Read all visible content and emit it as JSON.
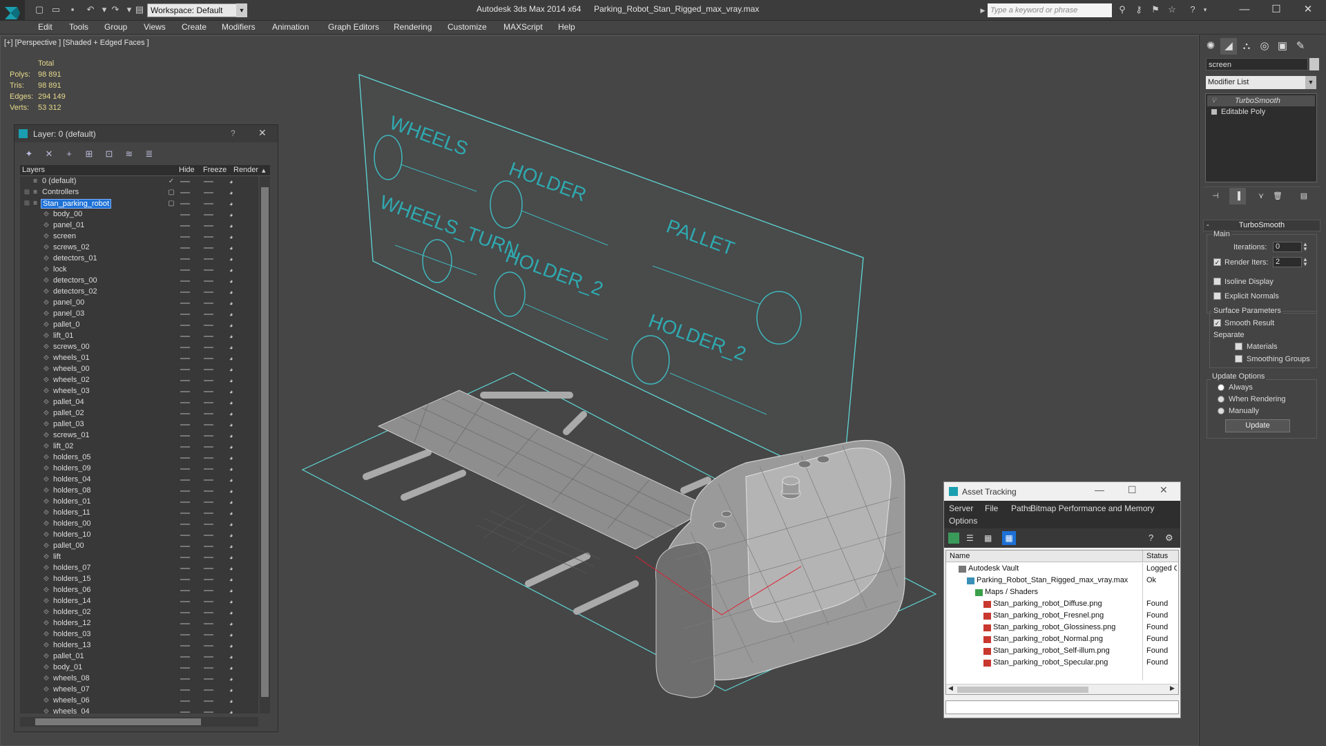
{
  "titlebar": {
    "app_title": "Autodesk 3ds Max  2014 x64",
    "doc_title": "Parking_Robot_Stan_Rigged_max_vray.max",
    "workspace": "Workspace: Default",
    "search_placeholder": "Type a keyword or phrase"
  },
  "menu": [
    "Edit",
    "Tools",
    "Group",
    "Views",
    "Create",
    "Modifiers",
    "Animation",
    "Graph Editors",
    "Rendering",
    "Customize",
    "MAXScript",
    "Help"
  ],
  "viewport": {
    "label": "[+] [Perspective ] [Shaded + Edged Faces ]",
    "stats_header": "Total",
    "stats": [
      {
        "label": "Polys:",
        "value": "98 891"
      },
      {
        "label": "Tris:",
        "value": "98 891"
      },
      {
        "label": "Edges:",
        "value": "294 149"
      },
      {
        "label": "Verts:",
        "value": "53 312"
      }
    ],
    "panel_labels": [
      "WHEELS",
      "HOLDER",
      "WHEELS_TURN",
      "HOLDER_2",
      "PALLET",
      "HOLDER_2"
    ]
  },
  "layer_window": {
    "title": "Layer: 0 (default)",
    "help": "?",
    "columns": {
      "layers": "Layers",
      "hide": "Hide",
      "freeze": "Freeze",
      "render": "Render"
    },
    "layers": [
      {
        "name": "0 (default)",
        "level": 0,
        "type": "layer",
        "check": true
      },
      {
        "name": "Controllers",
        "level": 0,
        "type": "layer",
        "box": true
      },
      {
        "name": "Stan_parking_robot",
        "level": 0,
        "type": "layer",
        "box": true,
        "selected": true
      },
      {
        "name": "body_00",
        "level": 1
      },
      {
        "name": "panel_01",
        "level": 1
      },
      {
        "name": "screen",
        "level": 1
      },
      {
        "name": "screws_02",
        "level": 1
      },
      {
        "name": "detectors_01",
        "level": 1
      },
      {
        "name": "lock",
        "level": 1
      },
      {
        "name": "detectors_00",
        "level": 1
      },
      {
        "name": "detectors_02",
        "level": 1
      },
      {
        "name": "panel_00",
        "level": 1
      },
      {
        "name": "panel_03",
        "level": 1
      },
      {
        "name": "pallet_0",
        "level": 1
      },
      {
        "name": "lift_01",
        "level": 1
      },
      {
        "name": "screws_00",
        "level": 1
      },
      {
        "name": "wheels_01",
        "level": 1
      },
      {
        "name": "wheels_00",
        "level": 1
      },
      {
        "name": "wheels_02",
        "level": 1
      },
      {
        "name": "wheels_03",
        "level": 1
      },
      {
        "name": "pallet_04",
        "level": 1
      },
      {
        "name": "pallet_02",
        "level": 1
      },
      {
        "name": "pallet_03",
        "level": 1
      },
      {
        "name": "screws_01",
        "level": 1
      },
      {
        "name": "lift_02",
        "level": 1
      },
      {
        "name": "holders_05",
        "level": 1
      },
      {
        "name": "holders_09",
        "level": 1
      },
      {
        "name": "holders_04",
        "level": 1
      },
      {
        "name": "holders_08",
        "level": 1
      },
      {
        "name": "holders_01",
        "level": 1
      },
      {
        "name": "holders_11",
        "level": 1
      },
      {
        "name": "holders_00",
        "level": 1
      },
      {
        "name": "holders_10",
        "level": 1
      },
      {
        "name": "pallet_00",
        "level": 1
      },
      {
        "name": "lift",
        "level": 1
      },
      {
        "name": "holders_07",
        "level": 1
      },
      {
        "name": "holders_15",
        "level": 1
      },
      {
        "name": "holders_06",
        "level": 1
      },
      {
        "name": "holders_14",
        "level": 1
      },
      {
        "name": "holders_02",
        "level": 1
      },
      {
        "name": "holders_12",
        "level": 1
      },
      {
        "name": "holders_03",
        "level": 1
      },
      {
        "name": "holders_13",
        "level": 1
      },
      {
        "name": "pallet_01",
        "level": 1
      },
      {
        "name": "body_01",
        "level": 1
      },
      {
        "name": "wheels_08",
        "level": 1
      },
      {
        "name": "wheels_07",
        "level": 1
      },
      {
        "name": "wheels_06",
        "level": 1
      },
      {
        "name": "wheels_04",
        "level": 1
      }
    ]
  },
  "asset_tracking": {
    "title": "Asset Tracking",
    "menu": [
      "Server",
      "File",
      "Paths",
      "Bitmap Performance and Memory",
      "Options"
    ],
    "columns": {
      "name": "Name",
      "status": "Status"
    },
    "rows": [
      {
        "name": "Autodesk Vault",
        "status": "Logged O",
        "indent": 1,
        "icon": "vault-icon"
      },
      {
        "name": "Parking_Robot_Stan_Rigged_max_vray.max",
        "status": "Ok",
        "indent": 2,
        "icon": "max-file-icon"
      },
      {
        "name": "Maps / Shaders",
        "status": "",
        "indent": 3,
        "icon": "maps-icon"
      },
      {
        "name": "Stan_parking_robot_Diffuse.png",
        "status": "Found",
        "indent": 4,
        "icon": "png-icon"
      },
      {
        "name": "Stan_parking_robot_Fresnel.png",
        "status": "Found",
        "indent": 4,
        "icon": "png-icon"
      },
      {
        "name": "Stan_parking_robot_Glossiness.png",
        "status": "Found",
        "indent": 4,
        "icon": "png-icon"
      },
      {
        "name": "Stan_parking_robot_Normal.png",
        "status": "Found",
        "indent": 4,
        "icon": "png-icon"
      },
      {
        "name": "Stan_parking_robot_Self-illum.png",
        "status": "Found",
        "indent": 4,
        "icon": "png-icon"
      },
      {
        "name": "Stan_parking_robot_Specular.png",
        "status": "Found",
        "indent": 4,
        "icon": "png-icon"
      }
    ]
  },
  "command_panel": {
    "object_name": "screen",
    "modifier_list": "Modifier List",
    "stack": [
      "TurboSmooth",
      "Editable Poly"
    ],
    "rollout_title": "TurboSmooth",
    "main_label": "Main",
    "iterations_label": "Iterations:",
    "iterations_value": "0",
    "render_iters_label": "Render Iters:",
    "render_iters_value": "2",
    "isoline": "Isoline Display",
    "explicit_normals": "Explicit Normals",
    "surface_params": "Surface Parameters",
    "smooth_result": "Smooth Result",
    "separate": "Separate",
    "materials": "Materials",
    "smoothing_groups": "Smoothing Groups",
    "update_options": "Update Options",
    "always": "Always",
    "when_rendering": "When Rendering",
    "manually": "Manually",
    "update_button": "Update"
  },
  "colors": {
    "accent": "#1d71d6",
    "grid": "#5fd6d6",
    "stats": "#e6d98c"
  }
}
